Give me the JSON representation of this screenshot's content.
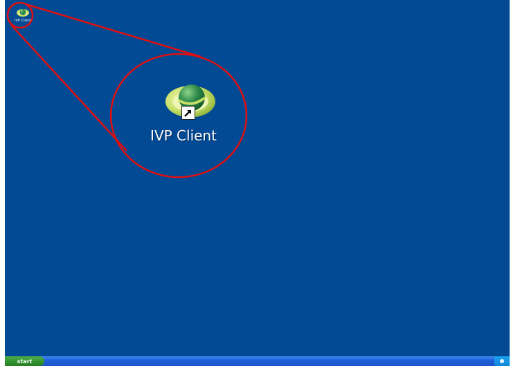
{
  "desktop": {
    "shortcut_small": {
      "label": "IVP Client",
      "icon": "ivp-client-planet-icon"
    },
    "shortcut_zoomed": {
      "label": "IVP Client",
      "icon": "ivp-client-planet-icon",
      "overlay_icon": "shortcut-arrow-icon"
    },
    "annotation": {
      "shape": "zoom-callout",
      "color": "#e01010"
    }
  },
  "taskbar": {
    "start_label": "start",
    "tray_icon": "tray-icon"
  },
  "colors": {
    "desktop_background": "#034a94",
    "taskbar": "#1f5fd9",
    "start_button": "#2f8f2a",
    "planet_ring": "#c8e06a",
    "planet_body": "#2e8a4a"
  }
}
